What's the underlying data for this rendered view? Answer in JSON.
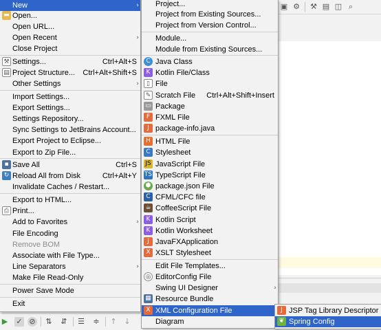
{
  "file_menu": {
    "items": [
      {
        "label": "New"
      },
      {
        "label": "Open..."
      },
      {
        "label": "Open URL..."
      },
      {
        "label": "Open Recent"
      },
      {
        "label": "Close Project"
      },
      {
        "label": "Settings...",
        "shortcut": "Ctrl+Alt+S"
      },
      {
        "label": "Project Structure...",
        "shortcut": "Ctrl+Alt+Shift+S"
      },
      {
        "label": "Other Settings"
      },
      {
        "label": "Import Settings..."
      },
      {
        "label": "Export Settings..."
      },
      {
        "label": "Settings Repository..."
      },
      {
        "label": "Sync Settings to JetBrains Account..."
      },
      {
        "label": "Export Project to Eclipse..."
      },
      {
        "label": "Export to Zip File..."
      },
      {
        "label": "Save All",
        "shortcut": "Ctrl+S"
      },
      {
        "label": "Reload All from Disk",
        "shortcut": "Ctrl+Alt+Y"
      },
      {
        "label": "Invalidate Caches / Restart..."
      },
      {
        "label": "Export to HTML..."
      },
      {
        "label": "Print..."
      },
      {
        "label": "Add to Favorites"
      },
      {
        "label": "File Encoding"
      },
      {
        "label": "Remove BOM"
      },
      {
        "label": "Associate with File Type..."
      },
      {
        "label": "Line Separators"
      },
      {
        "label": "Make File Read-Only"
      },
      {
        "label": "Power Save Mode"
      },
      {
        "label": "Exit"
      }
    ]
  },
  "new_menu": {
    "items": [
      {
        "label": "Project..."
      },
      {
        "label": "Project from Existing Sources..."
      },
      {
        "label": "Project from Version Control..."
      },
      {
        "label": "Module..."
      },
      {
        "label": "Module from Existing Sources..."
      },
      {
        "label": "Java Class"
      },
      {
        "label": "Kotlin File/Class"
      },
      {
        "label": "File"
      },
      {
        "label": "Scratch File",
        "shortcut": "Ctrl+Alt+Shift+Insert"
      },
      {
        "label": "Package"
      },
      {
        "label": "FXML File"
      },
      {
        "label": "package-info.java"
      },
      {
        "label": "HTML File"
      },
      {
        "label": "Stylesheet"
      },
      {
        "label": "JavaScript File"
      },
      {
        "label": "TypeScript File"
      },
      {
        "label": "package.json File"
      },
      {
        "label": "CFML/CFC file"
      },
      {
        "label": "CoffeeScript File"
      },
      {
        "label": "Kotlin Script"
      },
      {
        "label": "Kotlin Worksheet"
      },
      {
        "label": "JavaFXApplication"
      },
      {
        "label": "XSLT Stylesheet"
      },
      {
        "label": "Edit File Templates..."
      },
      {
        "label": "EditorConfig File"
      },
      {
        "label": "Swing UI Designer"
      },
      {
        "label": "Resource Bundle"
      },
      {
        "label": "XML Configuration File"
      },
      {
        "label": "Diagram"
      }
    ]
  },
  "xml_config_menu": {
    "items": [
      {
        "label": "JSP Tag Library Descriptor"
      },
      {
        "label": "Spring Config"
      }
    ]
  },
  "colors": {
    "selection": "#2f65ca",
    "menu_bg": "#f2f2f2",
    "separator": "#cfcfcf"
  }
}
